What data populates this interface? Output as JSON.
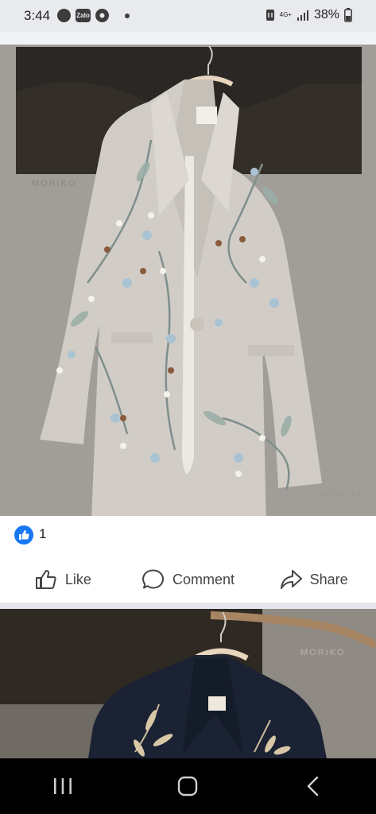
{
  "status": {
    "time": "3:44",
    "app_icons": [
      "whatsapp-icon",
      "zalo-icon",
      "chrome-icon"
    ],
    "zalo_label": "Zalo",
    "network_label": "4G+",
    "battery": "38%"
  },
  "post": {
    "reaction_count": "1",
    "actions": {
      "like": "Like",
      "comment": "Comment",
      "share": "Share"
    }
  },
  "watermark": {
    "brand": "MORIKO"
  },
  "colors": {
    "accent": "#1877f2",
    "nav_bg": "#000000",
    "status_bg": "#e8eaed"
  }
}
